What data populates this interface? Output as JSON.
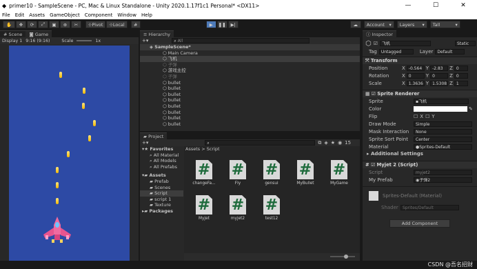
{
  "window": {
    "title": "primer10 - SampleScene - PC, Mac & Linux Standalone - Unity 2020.1.17f1c1 Personal* <DX11>",
    "minimize": "—",
    "maximize": "☐",
    "close": "✕"
  },
  "menu": [
    "File",
    "Edit",
    "Assets",
    "GameObject",
    "Component",
    "Window",
    "Help"
  ],
  "toolbar": {
    "pivot": "Pivot",
    "local": "Local",
    "account": "Account",
    "layers": "Layers",
    "layout": "Tall"
  },
  "scene": {
    "tab_scene": "Scene",
    "tab_game": "Game",
    "display": "Display 1",
    "aspect": "9:16 (9:16)",
    "scale_label": "Scale",
    "scale_value": "1x"
  },
  "hierarchy": {
    "tab": "Hierarchy",
    "search_placeholder": "All",
    "scene_name": "SampleScene*",
    "items": [
      "Main Camera",
      "飞机",
      "子弹",
      "游戏主控",
      "子弹",
      "bullet",
      "bullet",
      "bullet",
      "bullet",
      "bullet",
      "bullet",
      "bullet",
      "bullet"
    ]
  },
  "project": {
    "tab": "Project",
    "tree": {
      "favorites": "Favorites",
      "fav_items": [
        "All Material",
        "All Models",
        "All Prefabs"
      ],
      "assets": "Assets",
      "asset_items": [
        "Prefab",
        "Scenes",
        "Script",
        "script 1",
        "Texture"
      ],
      "packages": "Packages"
    },
    "breadcrumb": "Assets > Script",
    "files": [
      "changeFa...",
      "Fly",
      "gensui",
      "MyBullet",
      "MyGame",
      "MyJet",
      "myjet2",
      "test12"
    ],
    "count": "15"
  },
  "inspector": {
    "tab": "Inspector",
    "object_name": "飞机",
    "static": "Static",
    "tag_label": "Tag",
    "tag_value": "Untagged",
    "layer_label": "Layer",
    "layer_value": "Default",
    "transform": {
      "title": "Transform",
      "position": {
        "label": "Position",
        "x": "-0.564",
        "y": "-2.83",
        "z": "0"
      },
      "rotation": {
        "label": "Rotation",
        "x": "0",
        "y": "0",
        "z": "0"
      },
      "scale": {
        "label": "Scale",
        "x": "1.3636",
        "y": "1.5308",
        "z": "1"
      }
    },
    "sprite_renderer": {
      "title": "Sprite Renderer",
      "sprite_label": "Sprite",
      "sprite_value": "飞机",
      "color_label": "Color",
      "flip_label": "Flip",
      "flip_x": "X",
      "flip_y": "Y",
      "draw_mode_label": "Draw Mode",
      "draw_mode_value": "Simple",
      "mask_label": "Mask Interaction",
      "mask_value": "None",
      "sort_point_label": "Sprite Sort Point",
      "sort_point_value": "Center",
      "material_label": "Material",
      "material_value": "Sprites-Default",
      "additional": "Additional Settings"
    },
    "script": {
      "title": "Myjet 2 (Script)",
      "script_label": "Script",
      "script_value": "myjet2",
      "prefab_label": "My Prefab",
      "prefab_value": "子弹2"
    },
    "material": {
      "title": "Sprites-Default (Material)",
      "shader_label": "Shader",
      "shader_value": "Sprites/Default"
    },
    "add_component": "Add Component"
  },
  "watermark": "CSDN @吾名招财"
}
